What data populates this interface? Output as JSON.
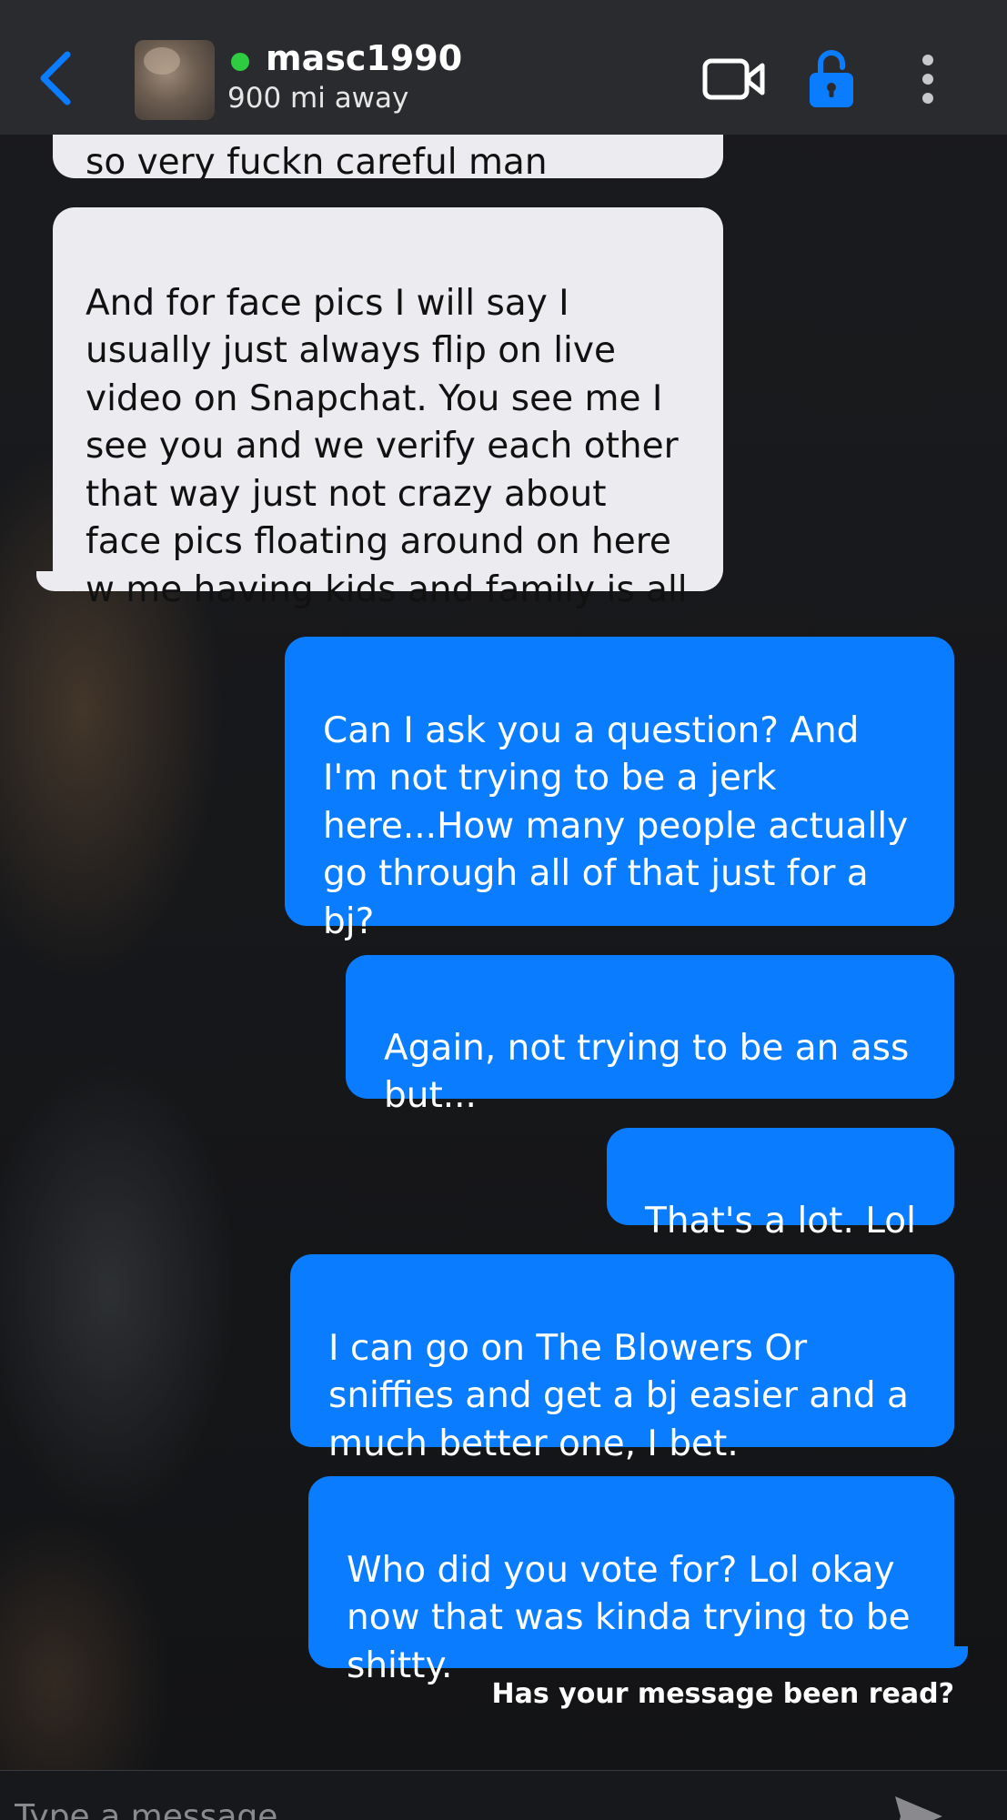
{
  "header": {
    "username": "masc1990",
    "distance": "900 mi away",
    "online_color": "#2ecc40",
    "icons": [
      "back-chevron-icon",
      "video-camera-icon",
      "unlock-icon",
      "more-vertical-icon"
    ]
  },
  "messages": [
    {
      "direction": "incoming",
      "text": "so very fuckn careful man",
      "partial": true
    },
    {
      "direction": "incoming",
      "text": "And for face pics I will say I\nusually just always flip on live\nvideo on Snapchat. You see me I\nsee you and we verify each other\nthat way just not crazy about\nface pics floating around on here\nw me having kids and family is all"
    },
    {
      "direction": "outgoing",
      "text": "Can I ask you a question? And\nI'm not trying to be a jerk\nhere...How many people actually\ngo through all of that just for a\nbj?"
    },
    {
      "direction": "outgoing",
      "text": "Again, not trying to be an ass\nbut..."
    },
    {
      "direction": "outgoing",
      "text": "That's a lot. Lol"
    },
    {
      "direction": "outgoing",
      "text": "I can go on The Blowers Or\nsniffies and get a bj easier and a\nmuch better one, I bet."
    },
    {
      "direction": "outgoing",
      "text": "Who did you vote for? Lol okay\nnow that was kinda trying to be\nshitty."
    }
  ],
  "read_receipt_label": "Has your message been read?",
  "composer": {
    "placeholder": "Type a message",
    "send_icon": "send-arrow-icon"
  },
  "colors": {
    "outgoing_bubble": "#0a7cff",
    "incoming_bubble": "#ececf0",
    "accent": "#0a7cff"
  }
}
